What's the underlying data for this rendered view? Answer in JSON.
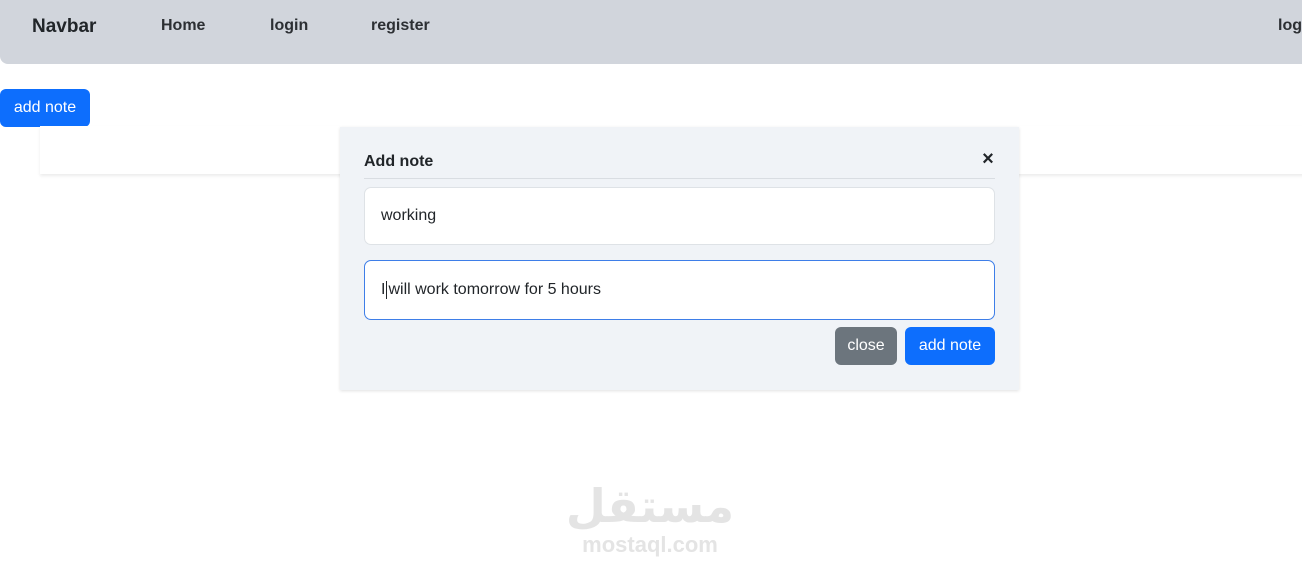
{
  "navbar": {
    "brand": "Navbar",
    "links": [
      "Home",
      "login",
      "register"
    ],
    "right_link": "log"
  },
  "page": {
    "add_note_button": "add note"
  },
  "modal": {
    "title": "Add note",
    "close_icon": "×",
    "title_field_value": "working",
    "body_field_prefix": "I",
    "body_field_rest": "will work tomorrow for 5 hours",
    "close_button": "close",
    "submit_button": "add note"
  },
  "watermark": {
    "arabic": "مستقل",
    "latin": "mostaql.com"
  },
  "colors": {
    "navbar_bg": "#d1d5dc",
    "primary": "#0d6efd",
    "secondary": "#6c757d",
    "modal_bg": "#f0f3f7",
    "focus_border": "#3e7ee8"
  }
}
